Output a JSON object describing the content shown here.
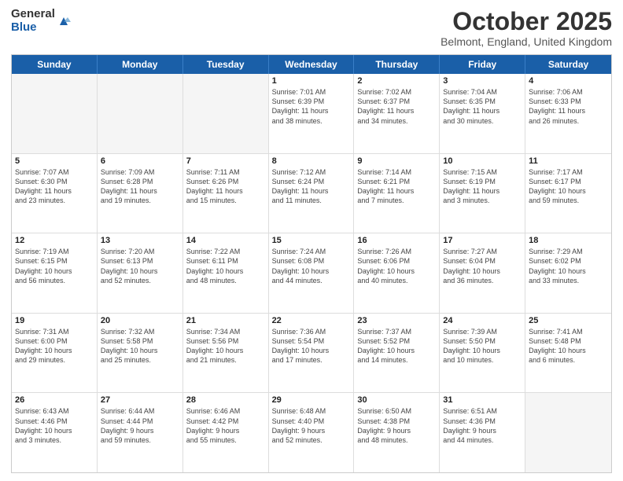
{
  "header": {
    "logo_general": "General",
    "logo_blue": "Blue",
    "month_title": "October 2025",
    "location": "Belmont, England, United Kingdom"
  },
  "day_headers": [
    "Sunday",
    "Monday",
    "Tuesday",
    "Wednesday",
    "Thursday",
    "Friday",
    "Saturday"
  ],
  "rows": [
    [
      {
        "date": "",
        "info": ""
      },
      {
        "date": "",
        "info": ""
      },
      {
        "date": "",
        "info": ""
      },
      {
        "date": "1",
        "info": "Sunrise: 7:01 AM\nSunset: 6:39 PM\nDaylight: 11 hours\nand 38 minutes."
      },
      {
        "date": "2",
        "info": "Sunrise: 7:02 AM\nSunset: 6:37 PM\nDaylight: 11 hours\nand 34 minutes."
      },
      {
        "date": "3",
        "info": "Sunrise: 7:04 AM\nSunset: 6:35 PM\nDaylight: 11 hours\nand 30 minutes."
      },
      {
        "date": "4",
        "info": "Sunrise: 7:06 AM\nSunset: 6:33 PM\nDaylight: 11 hours\nand 26 minutes."
      }
    ],
    [
      {
        "date": "5",
        "info": "Sunrise: 7:07 AM\nSunset: 6:30 PM\nDaylight: 11 hours\nand 23 minutes."
      },
      {
        "date": "6",
        "info": "Sunrise: 7:09 AM\nSunset: 6:28 PM\nDaylight: 11 hours\nand 19 minutes."
      },
      {
        "date": "7",
        "info": "Sunrise: 7:11 AM\nSunset: 6:26 PM\nDaylight: 11 hours\nand 15 minutes."
      },
      {
        "date": "8",
        "info": "Sunrise: 7:12 AM\nSunset: 6:24 PM\nDaylight: 11 hours\nand 11 minutes."
      },
      {
        "date": "9",
        "info": "Sunrise: 7:14 AM\nSunset: 6:21 PM\nDaylight: 11 hours\nand 7 minutes."
      },
      {
        "date": "10",
        "info": "Sunrise: 7:15 AM\nSunset: 6:19 PM\nDaylight: 11 hours\nand 3 minutes."
      },
      {
        "date": "11",
        "info": "Sunrise: 7:17 AM\nSunset: 6:17 PM\nDaylight: 10 hours\nand 59 minutes."
      }
    ],
    [
      {
        "date": "12",
        "info": "Sunrise: 7:19 AM\nSunset: 6:15 PM\nDaylight: 10 hours\nand 56 minutes."
      },
      {
        "date": "13",
        "info": "Sunrise: 7:20 AM\nSunset: 6:13 PM\nDaylight: 10 hours\nand 52 minutes."
      },
      {
        "date": "14",
        "info": "Sunrise: 7:22 AM\nSunset: 6:11 PM\nDaylight: 10 hours\nand 48 minutes."
      },
      {
        "date": "15",
        "info": "Sunrise: 7:24 AM\nSunset: 6:08 PM\nDaylight: 10 hours\nand 44 minutes."
      },
      {
        "date": "16",
        "info": "Sunrise: 7:26 AM\nSunset: 6:06 PM\nDaylight: 10 hours\nand 40 minutes."
      },
      {
        "date": "17",
        "info": "Sunrise: 7:27 AM\nSunset: 6:04 PM\nDaylight: 10 hours\nand 36 minutes."
      },
      {
        "date": "18",
        "info": "Sunrise: 7:29 AM\nSunset: 6:02 PM\nDaylight: 10 hours\nand 33 minutes."
      }
    ],
    [
      {
        "date": "19",
        "info": "Sunrise: 7:31 AM\nSunset: 6:00 PM\nDaylight: 10 hours\nand 29 minutes."
      },
      {
        "date": "20",
        "info": "Sunrise: 7:32 AM\nSunset: 5:58 PM\nDaylight: 10 hours\nand 25 minutes."
      },
      {
        "date": "21",
        "info": "Sunrise: 7:34 AM\nSunset: 5:56 PM\nDaylight: 10 hours\nand 21 minutes."
      },
      {
        "date": "22",
        "info": "Sunrise: 7:36 AM\nSunset: 5:54 PM\nDaylight: 10 hours\nand 17 minutes."
      },
      {
        "date": "23",
        "info": "Sunrise: 7:37 AM\nSunset: 5:52 PM\nDaylight: 10 hours\nand 14 minutes."
      },
      {
        "date": "24",
        "info": "Sunrise: 7:39 AM\nSunset: 5:50 PM\nDaylight: 10 hours\nand 10 minutes."
      },
      {
        "date": "25",
        "info": "Sunrise: 7:41 AM\nSunset: 5:48 PM\nDaylight: 10 hours\nand 6 minutes."
      }
    ],
    [
      {
        "date": "26",
        "info": "Sunrise: 6:43 AM\nSunset: 4:46 PM\nDaylight: 10 hours\nand 3 minutes."
      },
      {
        "date": "27",
        "info": "Sunrise: 6:44 AM\nSunset: 4:44 PM\nDaylight: 9 hours\nand 59 minutes."
      },
      {
        "date": "28",
        "info": "Sunrise: 6:46 AM\nSunset: 4:42 PM\nDaylight: 9 hours\nand 55 minutes."
      },
      {
        "date": "29",
        "info": "Sunrise: 6:48 AM\nSunset: 4:40 PM\nDaylight: 9 hours\nand 52 minutes."
      },
      {
        "date": "30",
        "info": "Sunrise: 6:50 AM\nSunset: 4:38 PM\nDaylight: 9 hours\nand 48 minutes."
      },
      {
        "date": "31",
        "info": "Sunrise: 6:51 AM\nSunset: 4:36 PM\nDaylight: 9 hours\nand 44 minutes."
      },
      {
        "date": "",
        "info": ""
      }
    ]
  ]
}
